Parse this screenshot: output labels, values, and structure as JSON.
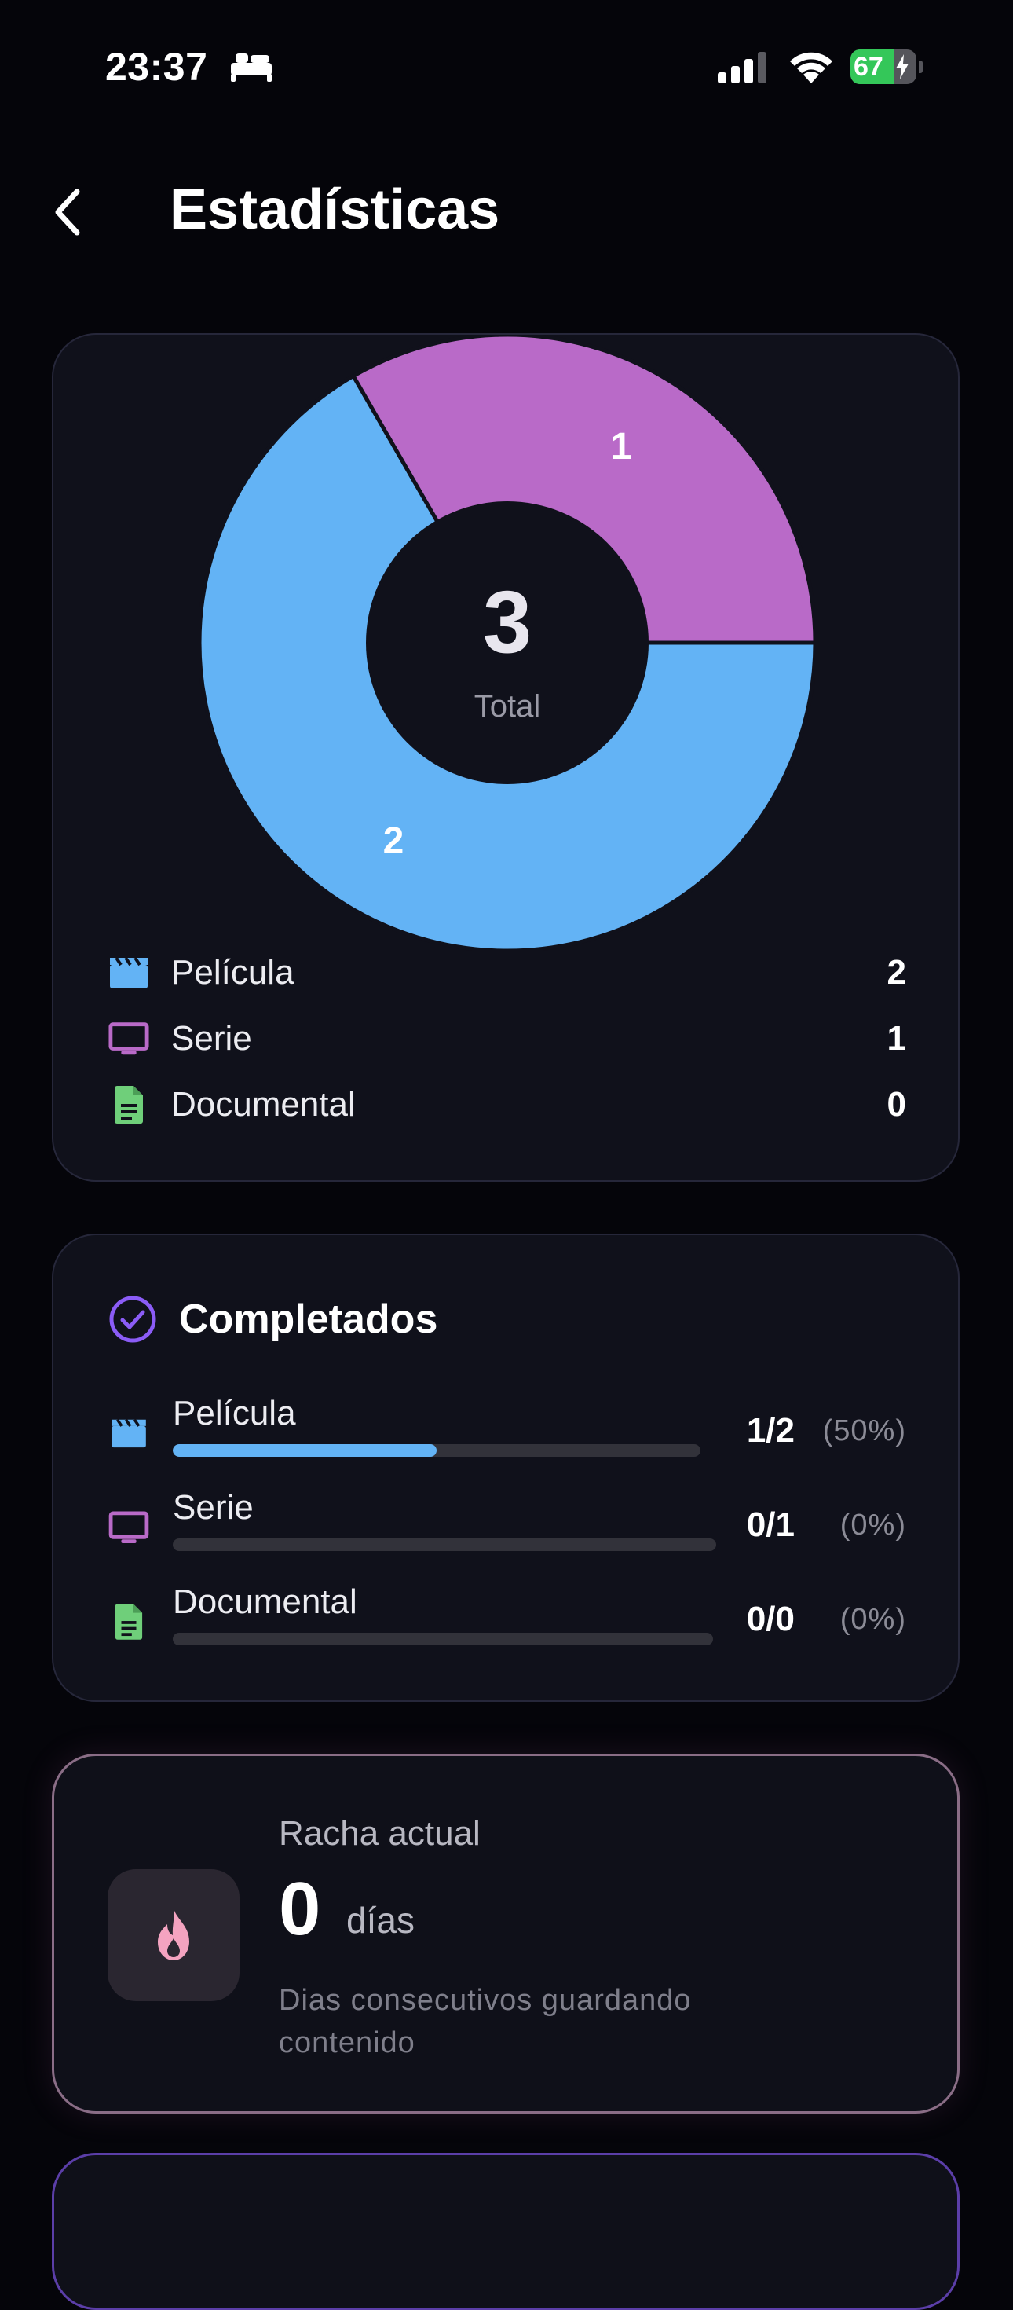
{
  "status_bar": {
    "time": "23:37",
    "battery": "67",
    "battery_level": 0.67
  },
  "header": {
    "title": "Estadísticas"
  },
  "colors": {
    "movie": "#63b3f5",
    "series": "#b96ac8",
    "documentary": "#6fcf7a",
    "accent": "#8b5cf6",
    "streak": "#f4a3c0"
  },
  "distribution": {
    "total_value": "3",
    "total_label": "Total",
    "slices": [
      {
        "name": "Película",
        "value": 2,
        "label": "2",
        "color": "#63b3f5"
      },
      {
        "name": "Serie",
        "value": 1,
        "label": "1",
        "color": "#b96ac8"
      }
    ],
    "legend": [
      {
        "label": "Película",
        "count": "2",
        "icon": "clapperboard-icon"
      },
      {
        "label": "Serie",
        "count": "1",
        "icon": "tv-icon"
      },
      {
        "label": "Documental",
        "count": "0",
        "icon": "document-icon"
      }
    ]
  },
  "completed": {
    "title": "Completados",
    "rows": [
      {
        "label": "Película",
        "fraction": "1/2",
        "percent": "(50%)",
        "progress": 0.5
      },
      {
        "label": "Serie",
        "fraction": "0/1",
        "percent": "(0%)",
        "progress": 0
      },
      {
        "label": "Documental",
        "fraction": "0/0",
        "percent": "(0%)",
        "progress": 0
      }
    ]
  },
  "streak": {
    "label": "Racha actual",
    "value": "0",
    "unit": "días",
    "description": "Dias consecutivos guardando contenido"
  }
}
